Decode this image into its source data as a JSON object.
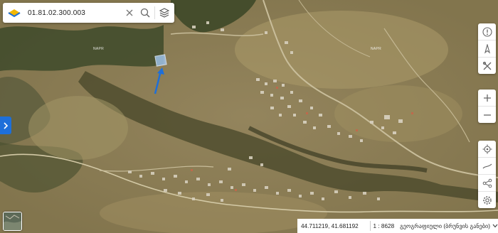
{
  "search": {
    "value": "01.81.02.300.003"
  },
  "map_labels": {
    "label_left": "NAPR",
    "label_right": "NAPR"
  },
  "status": {
    "coordinates": "44.711219, 41.681192",
    "scale_prefix": "1 :",
    "scale_value": "8628",
    "layer_name": "გეოგრაფიული (ბრუნვის განები)"
  },
  "icons": {
    "logo": "napr-logo",
    "clear": "close-icon",
    "search": "search-icon",
    "layers": "layers-icon",
    "info": "info-icon",
    "compass": "compass-icon",
    "tools": "tools-icon",
    "zoom_in": "plus-icon",
    "zoom_out": "minus-icon",
    "locate": "locate-icon",
    "measure": "measure-icon",
    "share": "share-icon",
    "settings": "gear-icon",
    "dropdown": "chevron-down-icon",
    "panel": "chevron-right-icon"
  },
  "colors": {
    "accent": "#1e6fd9",
    "parcel_highlight": "#9fc2e8"
  }
}
